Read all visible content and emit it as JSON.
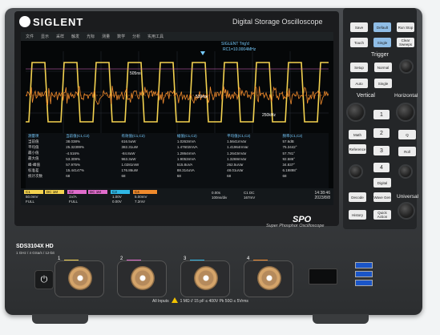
{
  "brand": {
    "name": "SIGLENT",
    "product_title": "Digital Storage Oscilloscope",
    "series_logo": "SPO",
    "series_subtitle": "Super Phosphor Oscilloscope"
  },
  "model": {
    "name": "SDS3104X HD",
    "specs": "1 GHz / 4 GSa/s / 12-bit"
  },
  "screen": {
    "menu": [
      "文件",
      "显示",
      "采样",
      "触发",
      "光标",
      "测量",
      "数学",
      "分析",
      "实用工具"
    ],
    "trigger_status": "SIGLENT Trig'd",
    "trigger_freq": "RC1=10.0004MHz",
    "markers": {
      "left": "505ns",
      "mid": "530mv",
      "right": "250kHz"
    },
    "measurements": {
      "headers": [
        "测量项",
        "当前值(C1,C2)",
        "有效值(C1,C2)",
        "幅值(C1,C2)",
        "平均值(C1,C2)",
        "频率(C1,C2)"
      ],
      "rows": [
        [
          "当前值",
          "38.038%",
          "616.5uW",
          "1.0263mVA",
          "1.5641mVar",
          "57.6dB"
        ],
        [
          "平均值",
          "25.32399%",
          "382.31uW",
          "1.47602mVA",
          "1.41964mVar",
          "75.3442°"
        ],
        [
          "最小值",
          "-4.516%",
          "-84.8uW",
          "1.2864mVA",
          "1.2643mVar",
          "57.781°"
        ],
        [
          "最大值",
          "53.309%",
          "963.3uW",
          "1.9053mVA",
          "1.3269mVar",
          "92.586°"
        ],
        [
          "峰-峰值",
          "57.975%",
          "1.0281mW",
          "515.8uVA",
          "262.5uVar",
          "34.837°"
        ],
        [
          "标准差",
          "15.44147%",
          "176.86uW",
          "88.314uVA",
          "48.01uVar",
          "6.19898°"
        ],
        [
          "统计次数",
          "68",
          "68",
          "68",
          "68",
          "68"
        ]
      ]
    },
    "channels": [
      {
        "label": "C1",
        "coupling": "DC 1M",
        "scale": "50.0mV",
        "offset": "FULL",
        "color": "#f3d24f"
      },
      {
        "label": "C2",
        "coupling": "DC 1M",
        "scale": "1V/A",
        "offset": "FULL",
        "color": "#e06ccc"
      },
      {
        "label": "C3",
        "coupling": "DC 1M",
        "scale": "1.00V",
        "offset": "0.00V",
        "color": "#2fb7e5"
      },
      {
        "label": "C4",
        "coupling": "DC 1M",
        "scale": "5.00mV",
        "offset": "7.2mV",
        "color": "#f08a2c"
      }
    ],
    "timebase": {
      "offset": "0.00s",
      "scale": "100ns/div",
      "rate": "2.00kpts 2.00GSa/s"
    },
    "trigger": {
      "source": "C1 DC",
      "level": "167mV",
      "mode": "Auto"
    },
    "clock": {
      "time": "14:38:46",
      "date": "2023/8/8"
    }
  },
  "buttons": {
    "save": "Save",
    "default": "Default",
    "run_stop": "Run Stop",
    "touch": "Touch",
    "single": "Single",
    "clear_sweeps": "Clear Sweeps",
    "setup": "Setup",
    "normal": "Normal",
    "auto": "Auto",
    "single2": "Single",
    "trigger_section": "Trigger",
    "vertical_section": "Vertical",
    "horizontal_section": "Horizontal",
    "universal_section": "Universal",
    "math": "Math",
    "reference": "Reference",
    "digital": "Digital",
    "decode": "Decode",
    "wave_gen": "Wave Gen",
    "history": "History",
    "quick_action": "Quick Action",
    "roll": "Roll",
    "search": "Search",
    "search_icon": "Q",
    "ch_nums": [
      "1",
      "2",
      "3",
      "4"
    ]
  },
  "front": {
    "inputs_text": "All Inputs",
    "inputs_spec": "1 MΩ // 15 pF ≤ 400V Pk      50Ω ≤ 5Vrms",
    "channel_tags": [
      "1",
      "2",
      "3",
      "4"
    ],
    "channel_colors": [
      "#f3d24f",
      "#e06ccc",
      "#2fb7e5",
      "#f08a2c"
    ],
    "power_icon": "power-icon"
  }
}
